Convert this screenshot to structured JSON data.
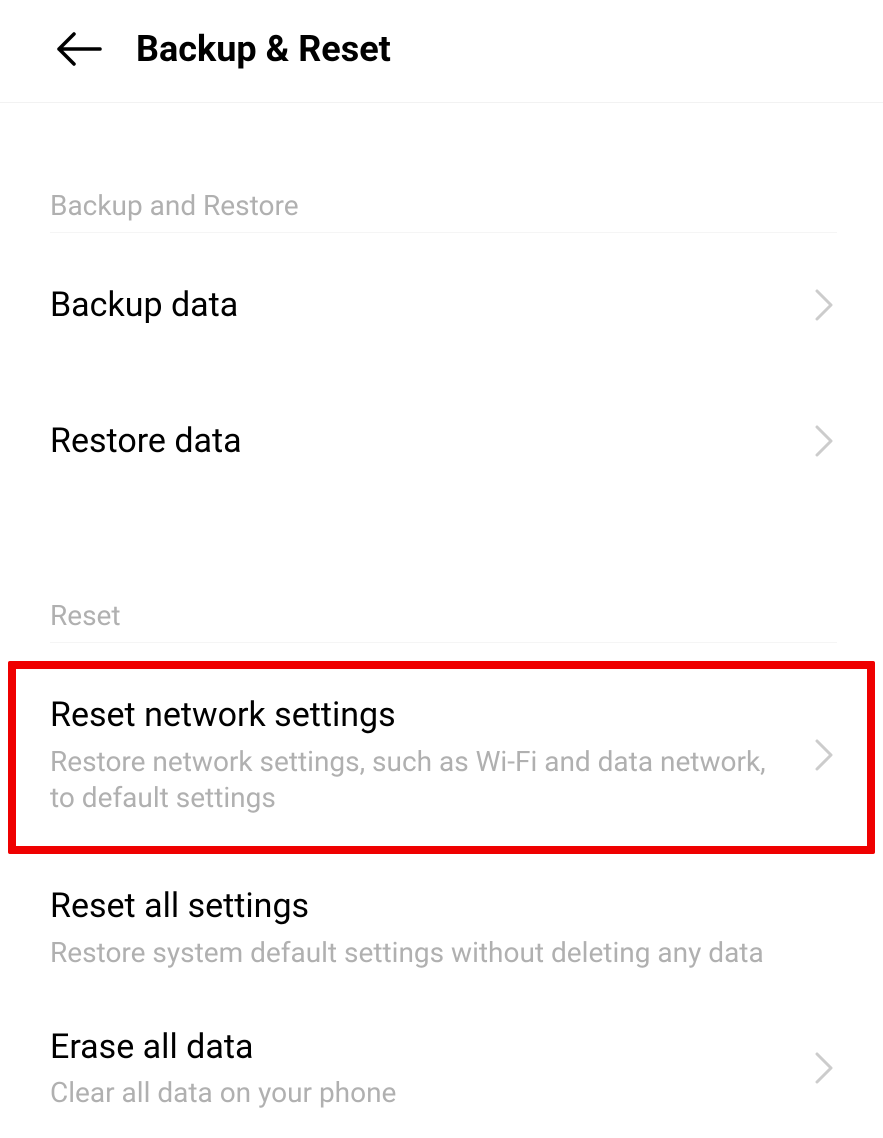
{
  "header": {
    "title": "Backup & Reset"
  },
  "sections": {
    "backup_restore": {
      "header": "Backup and Restore",
      "items": {
        "backup_data": {
          "title": "Backup data"
        },
        "restore_data": {
          "title": "Restore data"
        }
      }
    },
    "reset": {
      "header": "Reset",
      "items": {
        "reset_network": {
          "title": "Reset network settings",
          "subtitle": "Restore network settings, such as Wi-Fi and data network, to default settings"
        },
        "reset_all": {
          "title": "Reset all settings",
          "subtitle": "Restore system default settings without deleting any data"
        },
        "erase_all": {
          "title": "Erase all data",
          "subtitle": "Clear all data on your phone"
        }
      }
    }
  }
}
